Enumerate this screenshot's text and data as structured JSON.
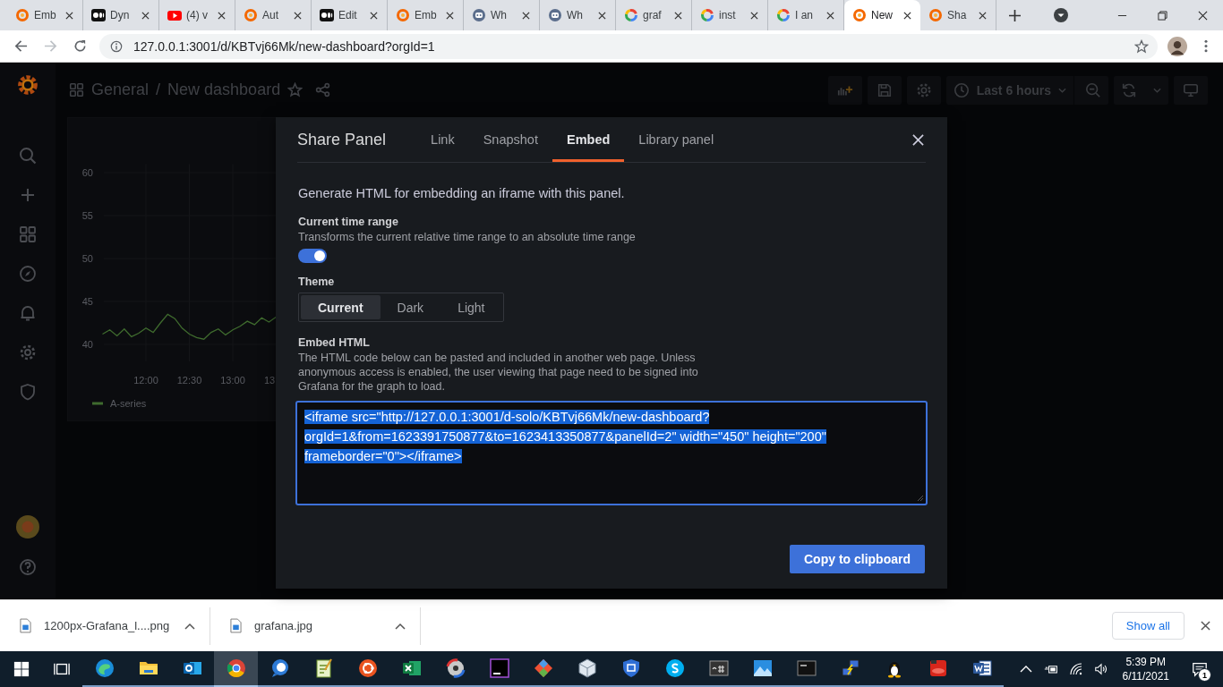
{
  "browser": {
    "tabs": [
      {
        "title": "Emb",
        "kind": "grafana",
        "selected": false
      },
      {
        "title": "Dyn",
        "kind": "medium",
        "selected": false
      },
      {
        "title": "(4) v",
        "kind": "youtube",
        "selected": false
      },
      {
        "title": "Aut",
        "kind": "grafana",
        "selected": false
      },
      {
        "title": "Edit",
        "kind": "medium",
        "selected": false
      },
      {
        "title": "Emb",
        "kind": "grafana",
        "selected": false
      },
      {
        "title": "Wh",
        "kind": "bot",
        "selected": false
      },
      {
        "title": "Wh",
        "kind": "bot",
        "selected": false
      },
      {
        "title": "graf",
        "kind": "google",
        "selected": false
      },
      {
        "title": "inst",
        "kind": "google",
        "selected": false
      },
      {
        "title": "I an",
        "kind": "google",
        "selected": false
      },
      {
        "title": "New",
        "kind": "grafana",
        "selected": true
      },
      {
        "title": "Sha",
        "kind": "grafana",
        "selected": false
      }
    ],
    "address": "127.0.0.1:3001/d/KBTvj66Mk/new-dashboard?orgId=1"
  },
  "dashboard": {
    "folder": "General",
    "separator": "/",
    "title": "New dashboard",
    "time_range": "Last 6 hours",
    "panel": {
      "chart_data": {
        "type": "line",
        "categories": [
          null,
          null,
          null,
          null,
          null,
          null,
          "12:00",
          null,
          null,
          null,
          null,
          null,
          "12:30",
          null,
          null,
          null,
          null,
          null,
          "13:00",
          null,
          null,
          null,
          null,
          null,
          "13"
        ],
        "ylim": [
          38,
          61
        ],
        "yticks": [
          40,
          45,
          50,
          55,
          60
        ],
        "series": [
          {
            "name": "A-series",
            "color": "#3f6b2e",
            "values": [
              41.2,
              41.7,
              41.0,
              41.8,
              40.9,
              41.3,
              41.9,
              41.4,
              42.5,
              43.5,
              43.0,
              41.9,
              41.2,
              40.8,
              40.6,
              41.4,
              41.8,
              41.1,
              41.7,
              42.1,
              42.7,
              42.3,
              43.1,
              42.6,
              43.2
            ]
          }
        ]
      }
    }
  },
  "share_modal": {
    "title": "Share Panel",
    "tabs": [
      {
        "label": "Link",
        "selected": false
      },
      {
        "label": "Snapshot",
        "selected": false
      },
      {
        "label": "Embed",
        "selected": true
      },
      {
        "label": "Library panel",
        "selected": false
      }
    ],
    "intro": "Generate HTML for embedding an iframe with this panel.",
    "time_range": {
      "label": "Current time range",
      "description": "Transforms the current relative time range to an absolute time range",
      "on": true
    },
    "theme": {
      "label": "Theme",
      "options": [
        {
          "label": "Current",
          "selected": true
        },
        {
          "label": "Dark",
          "selected": false
        },
        {
          "label": "Light",
          "selected": false
        }
      ]
    },
    "embed": {
      "label": "Embed HTML",
      "description": "The HTML code below can be pasted and included in another web page. Unless anonymous access is enabled, the user viewing that page need to be signed into Grafana for the graph to load.",
      "code": "<iframe src=\"http://127.0.0.1:3001/d-solo/KBTvj66Mk/new-dashboard?orgId=1&from=1623391750877&to=1623413350877&panelId=2\" width=\"450\" height=\"200\" frameborder=\"0\"></iframe>",
      "code_selected": true
    },
    "copy_button": "Copy to clipboard"
  },
  "downloads": {
    "items": [
      {
        "name": "1200px-Grafana_l....png"
      },
      {
        "name": "grafana.jpg"
      }
    ],
    "show_all": "Show all"
  },
  "taskbar": {
    "apps": [
      {
        "kind": "edge",
        "active": false
      },
      {
        "kind": "folder",
        "active": false
      },
      {
        "kind": "outlook",
        "active": false
      },
      {
        "kind": "chrome",
        "active": true
      },
      {
        "kind": "chat",
        "active": false
      },
      {
        "kind": "notepad",
        "active": false
      },
      {
        "kind": "ubuntu",
        "active": false
      },
      {
        "kind": "excel",
        "active": false
      },
      {
        "kind": "disc",
        "active": false
      },
      {
        "kind": "ide",
        "active": false
      },
      {
        "kind": "git",
        "active": false
      },
      {
        "kind": "cube",
        "active": false
      },
      {
        "kind": "shield",
        "active": false
      },
      {
        "kind": "skype",
        "active": false
      },
      {
        "kind": "terminal",
        "active": false
      },
      {
        "kind": "photos",
        "active": false
      },
      {
        "kind": "cmd",
        "active": false
      },
      {
        "kind": "network",
        "active": false
      },
      {
        "kind": "penguin",
        "active": false
      },
      {
        "kind": "red",
        "active": false
      },
      {
        "kind": "word",
        "active": false
      }
    ],
    "time": "5:39 PM",
    "date": "6/11/2021",
    "notifications": "1"
  }
}
